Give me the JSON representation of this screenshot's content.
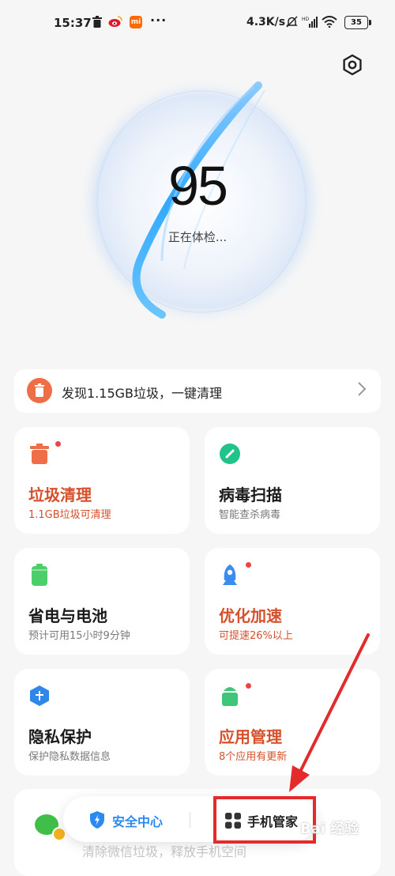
{
  "status_bar": {
    "time": "15:37",
    "notification_icons": [
      "trash-icon",
      "weibo-icon",
      "mi-icon"
    ],
    "mi_label": "mi",
    "overflow": "···",
    "net_speed": "4.3K/s",
    "battery": "35"
  },
  "score": {
    "value": "95",
    "status": "正在体检..."
  },
  "banner": {
    "text": "发现1.15GB垃圾，一键清理",
    "icon_color": "#ee6e47"
  },
  "cards": [
    {
      "title": "垃圾清理",
      "sub": "1.1GB垃圾可清理",
      "icon": "trash-can-icon",
      "icon_color": "#ee6e47",
      "dot": true,
      "highlight": true
    },
    {
      "title": "病毒扫描",
      "sub": "智能查杀病毒",
      "icon": "virus-scan-icon",
      "icon_color": "#20c38a",
      "dot": false,
      "highlight": false
    },
    {
      "title": "省电与电池",
      "sub": "预计可用15小时9分钟",
      "icon": "battery-icon",
      "icon_color": "#4ccf6a",
      "dot": false,
      "highlight": false
    },
    {
      "title": "优化加速",
      "sub": "可提速26%以上",
      "icon": "rocket-icon",
      "icon_color": "#3b8cf0",
      "dot": true,
      "highlight": true
    },
    {
      "title": "隐私保护",
      "sub": "保护隐私数据信息",
      "icon": "privacy-shield-icon",
      "icon_color": "#2f88e8",
      "dot": false,
      "highlight": false
    },
    {
      "title": "应用管理",
      "sub": "8个应用有更新",
      "icon": "app-manager-icon",
      "icon_color": "#3ec77a",
      "dot": true,
      "highlight": true
    }
  ],
  "bottom": {
    "clipped_text": "清除微信垃圾，释放手机空间",
    "nav": {
      "security_center": "安全中心",
      "phone_manager": "手机管家"
    },
    "watermark": "Bai 经验"
  },
  "colors": {
    "accent_orange": "#d5502b",
    "accent_blue": "#2b8af0",
    "annotation_red": "#e32b2b"
  }
}
